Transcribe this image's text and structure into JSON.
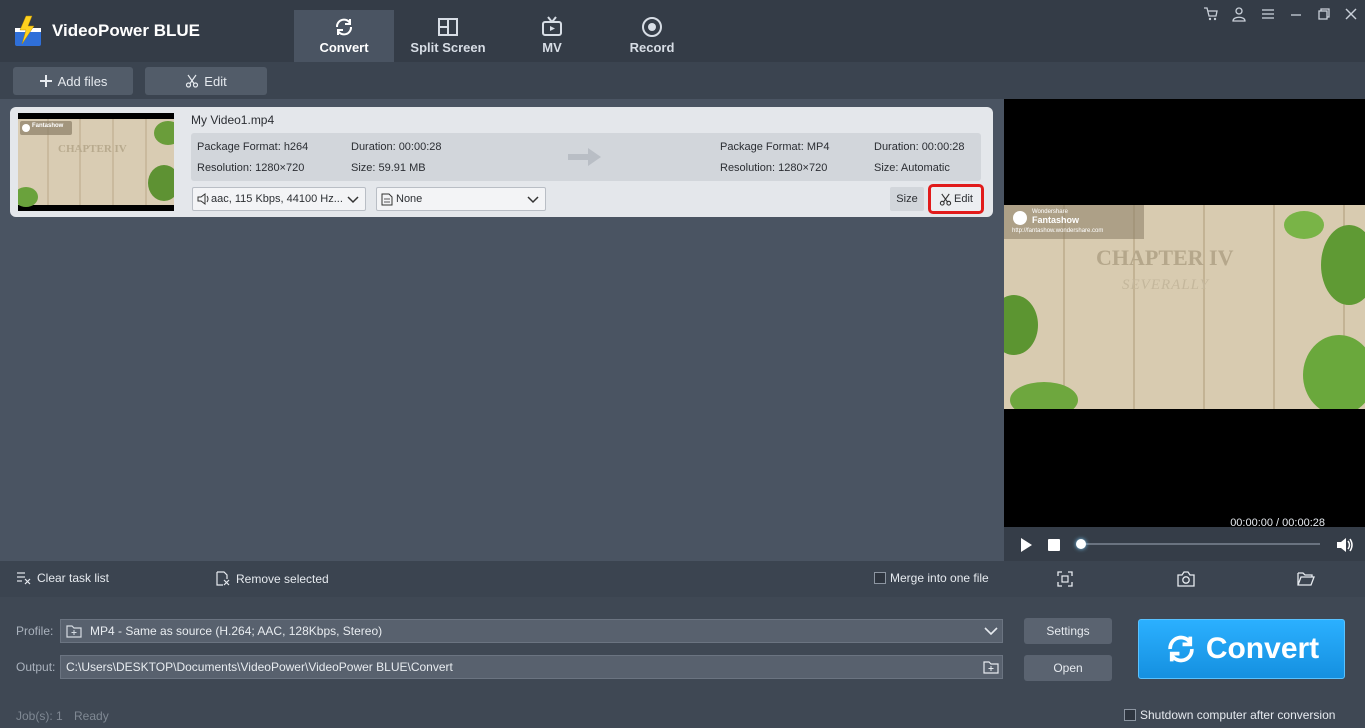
{
  "app": {
    "title": "VideoPower BLUE"
  },
  "tabs": [
    {
      "label": "Convert",
      "icon": "refresh-icon",
      "active": true
    },
    {
      "label": "Split Screen",
      "icon": "split-screen-icon",
      "active": false
    },
    {
      "label": "MV",
      "icon": "tv-icon",
      "active": false
    },
    {
      "label": "Record",
      "icon": "record-icon",
      "active": false
    }
  ],
  "window_controls": [
    "cart-icon",
    "user-icon",
    "menu-icon",
    "minimize-icon",
    "restore-icon",
    "close-icon"
  ],
  "toolbar": {
    "add_files_label": "Add files",
    "edit_label": "Edit"
  },
  "task": {
    "file_name": "My Video1.mp4",
    "thumb_brand": "Fantashow",
    "thumb_text": "CHAPTER IV",
    "source": {
      "package_format": "Package Format: h264",
      "duration": "Duration: 00:00:28",
      "resolution": "Resolution: 1280×720",
      "size": "Size: 59.91 MB"
    },
    "target": {
      "package_format": "Package Format: MP4",
      "duration": "Duration: 00:00:28",
      "resolution": "Resolution: 1280×720",
      "size": "Size: Automatic"
    },
    "audio_track": "aac, 115 Kbps, 44100 Hz...",
    "subtitle": "None",
    "size_button": "Size",
    "edit_button": "Edit"
  },
  "preview": {
    "brand": "Fantashow",
    "brand_small": "Wondershare",
    "url": "http://fantashow.wondershare.com",
    "chapter": "CHAPTER IV",
    "subtitle": "SEVERALLY",
    "time": "00:00:00 / 00:00:28",
    "progress": 0
  },
  "actions": {
    "clear_label": "Clear task list",
    "remove_label": "Remove selected",
    "merge_label": "Merge into one file",
    "merge_checked": false
  },
  "settings": {
    "profile_label": "Profile:",
    "profile_value": "MP4 - Same as source (H.264; AAC, 128Kbps, Stereo)",
    "output_label": "Output:",
    "output_value": "C:\\Users\\DESKTOP\\Documents\\VideoPower\\VideoPower BLUE\\Convert",
    "settings_button": "Settings",
    "open_button": "Open",
    "convert_button": "Convert"
  },
  "status": {
    "jobs": "Job(s): 1",
    "state": "Ready",
    "shutdown_label": "Shutdown computer after conversion",
    "shutdown_checked": false
  },
  "colors": {
    "accent": "#1da1f2",
    "highlight": "#e11b1b"
  }
}
